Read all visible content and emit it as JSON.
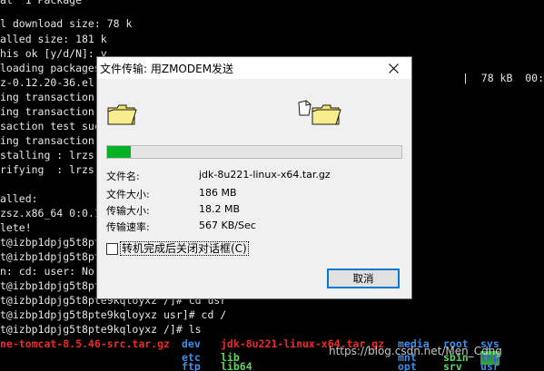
{
  "terminal": {
    "lines": [
      "al  1 Package",
      "l download size: 78 k",
      "alled size: 181 k",
      "his ok [y/d/N]: y",
      "loading packages:",
      "z-0.12.20-36.el",
      "ing transaction",
      "ing transaction",
      "saction test suc",
      "ing transaction",
      "stalling : lrzs",
      "rifying  : lrzs",
      "",
      "alled:",
      "zsz.x86_64 0:0.1",
      "",
      "lete!",
      "t@izbp1dpjg5t8pt",
      "t@izbp1dpjg5t8pt",
      "n: cd: user: No",
      "t@izbp1dpjg5t8pt",
      "t@izbp1dpjg5t8pte9kqloyxz /]# cd usr",
      "t@izbp1dpjg5t8pte9kqloyxz usr]# cd /",
      "t@izbp1dpjg5t8pte9kqloyxz /]# ls"
    ],
    "right_text": "|  78 kB  00:",
    "ls_items": {
      "tomcat": "ne-tomcat-8.5.46-src.tar.gz",
      "dev": "dev",
      "jdk": "jdk-8u221-linux-x64.tar.gz",
      "media": "media",
      "root": "root",
      "sys": "sys",
      "etc": "etc",
      "lib": "lib",
      "mnt": "mnt",
      "sbin": "sbin",
      "tmp": "tmp",
      "ftp": "ftp",
      "lib64": "lib64",
      "opt": "opt",
      "srv": "srv",
      "usr": "usr"
    },
    "watermark": "https://blog.csdn.net/Men_Cdng"
  },
  "dialog": {
    "title": "文件传输: 用ZMODEM发送",
    "progress_fraction": 0.08,
    "fields": [
      {
        "label": "文件名:",
        "value": "jdk-8u221-linux-x64.tar.gz"
      },
      {
        "label": "文件大小:",
        "value": "186 MB"
      },
      {
        "label": "传输大小:",
        "value": "18.2 MB"
      },
      {
        "label": "传输速率:",
        "value": "567 KB/Sec"
      }
    ],
    "checkbox_label": "转机完成后关闭对话框(C)",
    "checkbox_checked": false,
    "cancel_label": "取消"
  },
  "colors": {
    "progress": "#06b025",
    "folder": "#f2e36b",
    "ls_red": "#ef2929",
    "ls_blue": "#3b8eea",
    "ls_green": "#5fd75f"
  }
}
